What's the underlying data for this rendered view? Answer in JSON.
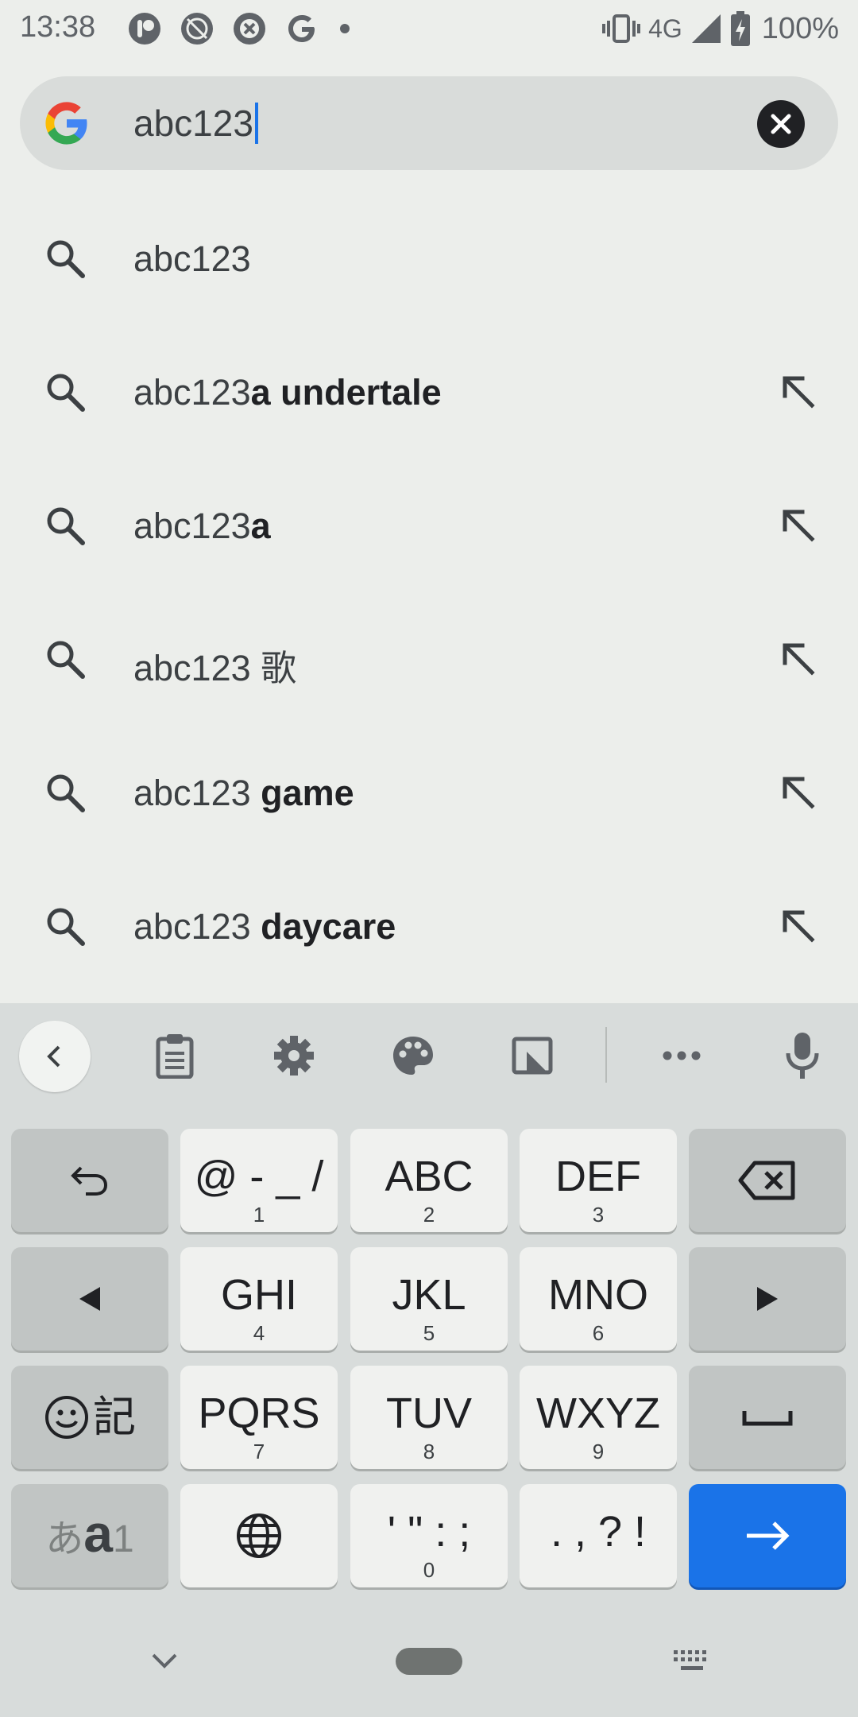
{
  "status_bar": {
    "time": "13:38",
    "network": "4G",
    "battery": "100%",
    "icons": [
      "notification-app-icon",
      "mute-icon",
      "blocked-icon",
      "google-icon",
      "dot-icon",
      "vibrate-icon",
      "signal-icon",
      "battery-charging-icon"
    ]
  },
  "search": {
    "query": "abc123",
    "logo": "google-g-icon",
    "clear_icon": "close-icon"
  },
  "suggestions": [
    {
      "prefix": "abc123",
      "bold": "",
      "has_arrow": false
    },
    {
      "prefix": "abc123",
      "bold": "a undertale",
      "has_arrow": true
    },
    {
      "prefix": "abc123",
      "bold": "a",
      "has_arrow": true
    },
    {
      "prefix": "abc123 歌",
      "bold": "",
      "has_arrow": true
    },
    {
      "prefix": "abc123 ",
      "bold": "game",
      "has_arrow": true
    },
    {
      "prefix": "abc123 ",
      "bold": "daycare",
      "has_arrow": true
    }
  ],
  "keyboard": {
    "toolbar": [
      "back-icon",
      "clipboard-icon",
      "settings-icon",
      "palette-icon",
      "one-handed-icon",
      "more-icon",
      "microphone-icon"
    ],
    "rows": [
      [
        {
          "main": "↺",
          "sub": ""
        },
        {
          "main": "@ - _ /",
          "sub": "1"
        },
        {
          "main": "ABC",
          "sub": "2"
        },
        {
          "main": "DEF",
          "sub": "3"
        },
        {
          "main": "⌫",
          "sub": ""
        }
      ],
      [
        {
          "main": "◀",
          "sub": ""
        },
        {
          "main": "GHI",
          "sub": "4"
        },
        {
          "main": "JKL",
          "sub": "5"
        },
        {
          "main": "MNO",
          "sub": "6"
        },
        {
          "main": "▶",
          "sub": ""
        }
      ],
      [
        {
          "main": "☺記",
          "sub": ""
        },
        {
          "main": "PQRS",
          "sub": "7"
        },
        {
          "main": "TUV",
          "sub": "8"
        },
        {
          "main": "WXYZ",
          "sub": "9"
        },
        {
          "main": "␣",
          "sub": ""
        }
      ],
      [
        {
          "main": "あa1",
          "sub": ""
        },
        {
          "main": "🌐",
          "sub": ""
        },
        {
          "main": "' \" : ;",
          "sub": "0"
        },
        {
          "main": ". , ? !",
          "sub": ""
        },
        {
          "main": "→",
          "sub": ""
        }
      ]
    ]
  },
  "nav": {
    "hide_icon": "chevron-down-icon",
    "switch_icon": "keyboard-icon"
  }
}
